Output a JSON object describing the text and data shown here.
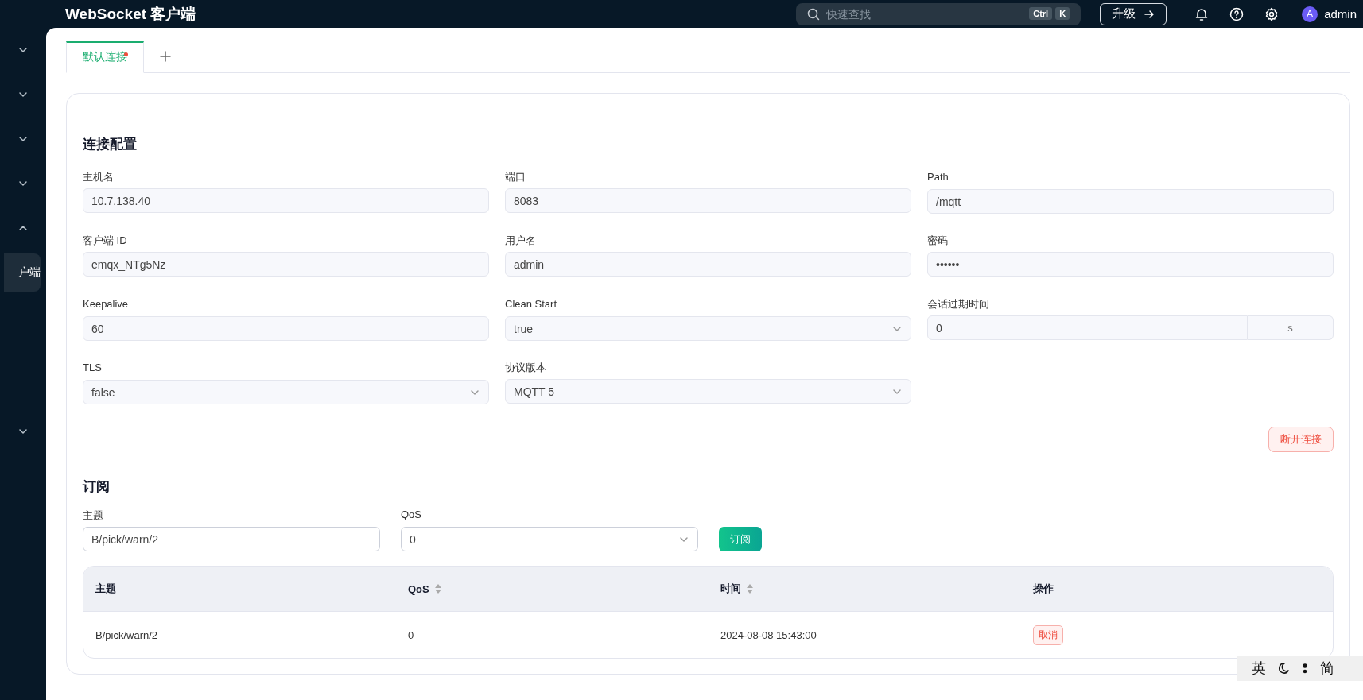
{
  "topbar": {
    "title": "WebSocket 客户端",
    "search": {
      "placeholder": "快速查找",
      "keys": [
        "Ctrl",
        "K"
      ]
    },
    "upgrade_button": "升级",
    "avatar": "A",
    "user": "admin"
  },
  "sidebar": {
    "items": [
      {
        "kind": "group",
        "expanded": false
      },
      {
        "kind": "group",
        "expanded": false
      },
      {
        "kind": "group",
        "expanded": false
      },
      {
        "kind": "group",
        "expanded": false
      },
      {
        "kind": "group",
        "expanded": true
      },
      {
        "kind": "link",
        "label": "户端",
        "selected": true
      },
      {
        "kind": "gap"
      },
      {
        "kind": "group",
        "expanded": false
      }
    ]
  },
  "tabs": [
    {
      "label": "默认连接",
      "selected": true,
      "unread": true
    }
  ],
  "connection": {
    "title": "连接配置",
    "fields": [
      {
        "label": "主机名",
        "kind": "input",
        "value": "10.7.138.40"
      },
      {
        "label": "端口",
        "kind": "input",
        "value": "8083"
      },
      {
        "label": "Path",
        "kind": "input",
        "value": "/mqtt"
      },
      {
        "label": "客户端 ID",
        "kind": "input",
        "value": "emqx_NTg5Nz"
      },
      {
        "label": "用户名",
        "kind": "input",
        "value": "admin"
      },
      {
        "label": "密码",
        "kind": "input",
        "value": "••••••"
      },
      {
        "label": "Keepalive",
        "kind": "input",
        "value": "60"
      },
      {
        "label": "Clean Start",
        "kind": "select",
        "value": "true"
      },
      {
        "label": "会话过期时间",
        "kind": "unit",
        "value": "0",
        "unit": "s"
      },
      {
        "label": "TLS",
        "kind": "select",
        "value": "false"
      },
      {
        "label": "协议版本",
        "kind": "select",
        "value": "MQTT 5"
      }
    ],
    "disconnect_button": "断开连接"
  },
  "subscribe": {
    "title": "订阅",
    "topic": {
      "label": "主题",
      "value": "B/pick/warn/2"
    },
    "qos": {
      "label": "QoS",
      "value": "0"
    },
    "button": "订阅",
    "table": {
      "columns": [
        {
          "label": "主题",
          "sortable": false
        },
        {
          "label": "QoS",
          "sortable": true
        },
        {
          "label": "时间",
          "sortable": true
        },
        {
          "label": "操作",
          "sortable": false
        }
      ],
      "rows": [
        {
          "topic": "B/pick/warn/2",
          "qos": "0",
          "time": "2024-08-08 15:43:00",
          "action": "取消"
        }
      ]
    }
  },
  "ime_bar": {
    "mode": "英",
    "script": "简"
  }
}
